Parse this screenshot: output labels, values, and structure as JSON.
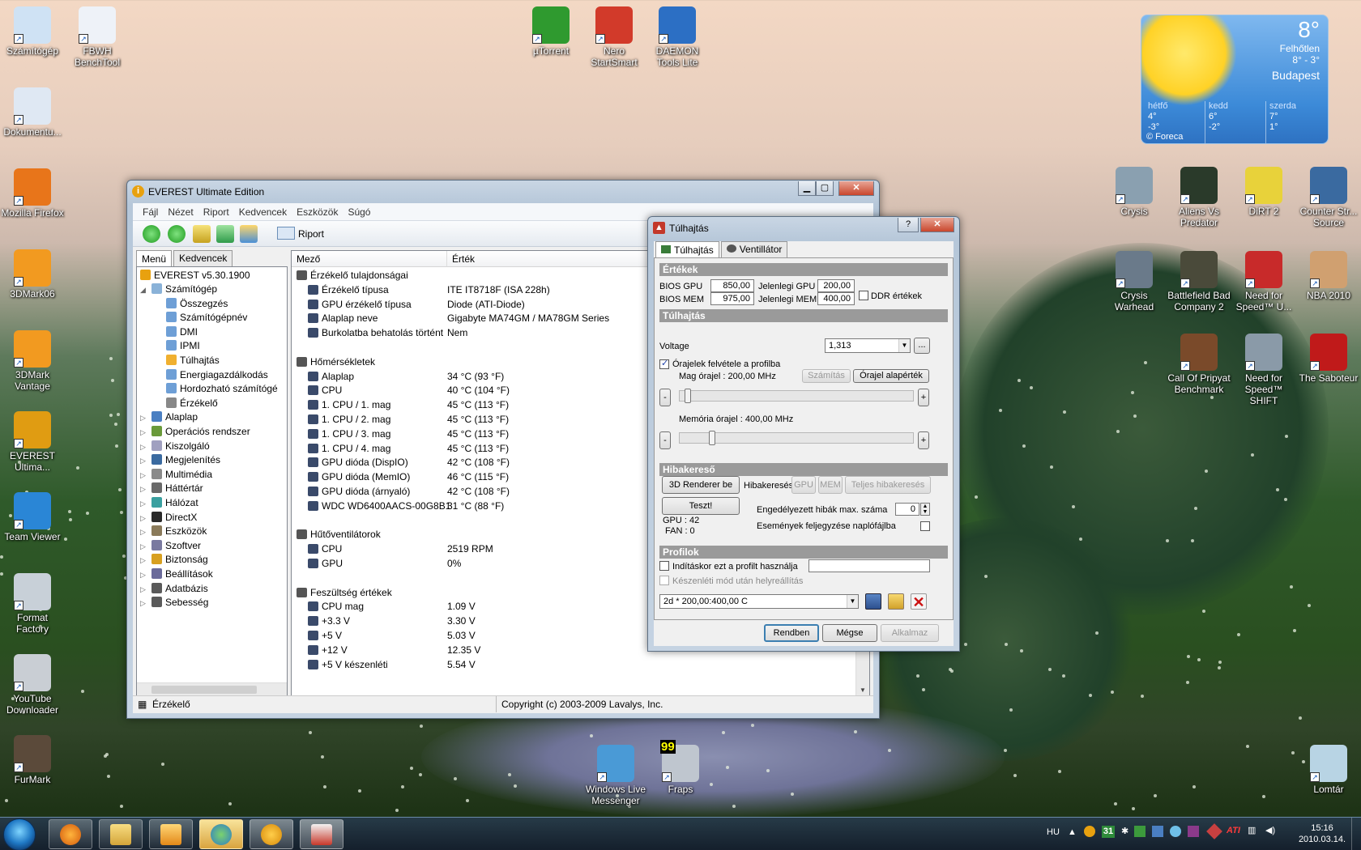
{
  "desktop": {
    "icons_left": [
      {
        "label": "Számítógép",
        "icon": "computer-icon"
      },
      {
        "label": "FBWH BenchTool",
        "icon": "document-icon"
      },
      {
        "label": "Dokumentu...",
        "icon": "document-icon"
      },
      {
        "label": "Mozilla Firefox",
        "icon": "firefox-icon"
      },
      {
        "label": "3DMark06",
        "icon": "3dmark-icon"
      },
      {
        "label": "3DMark Vantage",
        "icon": "3dmark-icon"
      },
      {
        "label": "EVEREST Ultima...",
        "icon": "everest-icon"
      },
      {
        "label": "Team Viewer",
        "icon": "teamviewer-icon"
      },
      {
        "label": "Format Factory",
        "icon": "formatfactory-icon"
      },
      {
        "label": "YouTube Downloader",
        "icon": "youtube-downloader-icon"
      },
      {
        "label": "FurMark",
        "icon": "furmark-icon"
      }
    ],
    "icons_top": [
      {
        "label": "µTorrent",
        "icon": "utorrent-icon"
      },
      {
        "label": "Nero StartSmart",
        "icon": "nero-icon"
      },
      {
        "label": "DAEMON Tools Lite",
        "icon": "daemon-icon"
      }
    ],
    "icons_right": [
      {
        "label": "Crysis",
        "icon": "crysis-icon"
      },
      {
        "label": "Aliens Vs Predator",
        "icon": "avp-icon"
      },
      {
        "label": "DiRT 2",
        "icon": "dirt-icon"
      },
      {
        "label": "Counter Str... Source",
        "icon": "counterstrike-icon"
      },
      {
        "label": "Crysis Warhead",
        "icon": "crysis-icon"
      },
      {
        "label": "Battlefield Bad Company 2",
        "icon": "battlefield-icon"
      },
      {
        "label": "Need for Speed™ U...",
        "icon": "nfs-icon"
      },
      {
        "label": "NBA 2010",
        "icon": "nba-icon"
      },
      {
        "label": "Call Of Pripyat Benchmark",
        "icon": "stalker-icon"
      },
      {
        "label": "Need for Speed™ SHIFT",
        "icon": "nfs-icon"
      },
      {
        "label": "The Saboteur",
        "icon": "saboteur-icon"
      }
    ],
    "icons_bottom": [
      {
        "label": "Windows Live Messenger",
        "icon": "messenger-icon"
      },
      {
        "label": "Fraps",
        "icon": "fraps-icon"
      },
      {
        "label": "Lomtár",
        "icon": "recycle-bin-icon"
      }
    ],
    "fraps_counter": "99"
  },
  "weather": {
    "temp": "8°",
    "condition": "Felhőtlen",
    "range": "8° - 3°",
    "city": "Budapest",
    "days": [
      {
        "name": "hétfő",
        "hi": "4°",
        "lo": "-3°"
      },
      {
        "name": "kedd",
        "hi": "6°",
        "lo": "-2°"
      },
      {
        "name": "szerda",
        "hi": "7°",
        "lo": "1°"
      }
    ],
    "credit": "© Foreca"
  },
  "everest": {
    "title": "EVEREST Ultimate Edition",
    "menu": [
      "Fájl",
      "Nézet",
      "Riport",
      "Kedvencek",
      "Eszközök",
      "Súgó"
    ],
    "report_label": "Riport",
    "tabs": [
      "Menü",
      "Kedvencek"
    ],
    "tree_root": "EVEREST v5.30.1900",
    "tree_computer": "Számítógép",
    "tree_computer_children": [
      "Összegzés",
      "Számítógépnév",
      "DMI",
      "IPMI",
      "Túlhajtás",
      "Energiagazdálkodás",
      "Hordozható számítógé",
      "Érzékelő"
    ],
    "tree_other": [
      "Alaplap",
      "Operációs rendszer",
      "Kiszolgáló",
      "Megjelenítés",
      "Multimédia",
      "Háttértár",
      "Hálózat",
      "DirectX",
      "Eszközök",
      "Szoftver",
      "Biztonság",
      "Beállítások",
      "Adatbázis",
      "Sebesség"
    ],
    "col_field": "Mező",
    "col_value": "Érték",
    "rows": [
      {
        "field": "Érzékelő tulajdonságai",
        "value": "",
        "section": true
      },
      {
        "field": "Érzékelő típusa",
        "value": "ITE IT8718F  (ISA 228h)"
      },
      {
        "field": "GPU érzékelő típusa",
        "value": "Diode  (ATI-Diode)"
      },
      {
        "field": "Alaplap neve",
        "value": "Gigabyte MA74GM / MA78GM Series"
      },
      {
        "field": "Burkolatba behatolás történt",
        "value": "Nem"
      },
      {
        "field": "",
        "value": "",
        "blank": true
      },
      {
        "field": "Hőmérsékletek",
        "value": "",
        "section": true
      },
      {
        "field": "Alaplap",
        "value": "34 °C  (93 °F)"
      },
      {
        "field": "CPU",
        "value": "40 °C  (104 °F)"
      },
      {
        "field": "1. CPU / 1. mag",
        "value": "45 °C  (113 °F)"
      },
      {
        "field": "1. CPU / 2. mag",
        "value": "45 °C  (113 °F)"
      },
      {
        "field": "1. CPU / 3. mag",
        "value": "45 °C  (113 °F)"
      },
      {
        "field": "1. CPU / 4. mag",
        "value": "45 °C  (113 °F)"
      },
      {
        "field": "GPU dióda (DispIO)",
        "value": "42 °C  (108 °F)"
      },
      {
        "field": "GPU dióda (MemIO)",
        "value": "46 °C  (115 °F)"
      },
      {
        "field": "GPU dióda (árnyaló)",
        "value": "42 °C  (108 °F)"
      },
      {
        "field": "WDC WD6400AACS-00G8B1",
        "value": "31 °C  (88 °F)"
      },
      {
        "field": "",
        "value": "",
        "blank": true
      },
      {
        "field": "Hűtőventilátorok",
        "value": "",
        "section": true
      },
      {
        "field": "CPU",
        "value": "2519 RPM"
      },
      {
        "field": "GPU",
        "value": "0%"
      },
      {
        "field": "",
        "value": "",
        "blank": true
      },
      {
        "field": "Feszültség értékek",
        "value": "",
        "section": true
      },
      {
        "field": "CPU mag",
        "value": "1.09 V"
      },
      {
        "field": "+3.3 V",
        "value": "3.30 V"
      },
      {
        "field": "+5 V",
        "value": "5.03 V"
      },
      {
        "field": "+12 V",
        "value": "12.35 V"
      },
      {
        "field": "+5 V készenléti",
        "value": "5.54 V"
      }
    ],
    "status_left": "Érzékelő",
    "status_right": "Copyright (c) 2003-2009 Lavalys, Inc."
  },
  "overclock": {
    "title": "Túlhajtás",
    "tabs": [
      "Túlhajtás",
      "Ventillátor"
    ],
    "sec_values": "Értékek",
    "bios_gpu_label": "BIOS GPU",
    "bios_gpu": "850,00",
    "bios_mem_label": "BIOS MEM",
    "bios_mem": "975,00",
    "cur_gpu_label": "Jelenlegi GPU",
    "cur_gpu": "200,00",
    "cur_mem_label": "Jelenlegi MEM",
    "cur_mem": "400,00",
    "ddr_label": "DDR értékek",
    "sec_oc": "Túlhajtás",
    "voltage_label": "Voltage",
    "voltage": "1,313",
    "more_btn": "...",
    "save_clocks_label": "Órajelek felvétele a profilba",
    "core_clock_label": "Mag órajel : 200,00 MHz",
    "calc_btn": "Számítás",
    "default_btn": "Órajel alapérték",
    "core_slider_level": 0.02,
    "mem_clock_label": "Memória órajel : 400,00 MHz",
    "mem_slider_level": 0.13,
    "minus": "-",
    "plus": "+",
    "sec_debug": "Hibakereső",
    "renderer_btn": "3D Renderer be",
    "debug_label": "Hibakeresés",
    "gpu_btn": "GPU",
    "mem_btn": "MEM",
    "full_debug_btn": "Teljes hibakeresés",
    "test_btn": "Teszt!",
    "max_errors_label": "Engedélyezett hibák max. száma",
    "max_errors": "0",
    "log_label": "Események feljegyzése naplófájlba",
    "gpu_status": "GPU : 42",
    "fan_status": "FAN : 0",
    "sec_profiles": "Profilok",
    "startup_profile_label": "Indításkor ezt a profilt használja",
    "restore_label": "Készenléti mód után helyreállítás",
    "profile": "2d * 200,00:400,00 C",
    "ok_btn": "Rendben",
    "cancel_btn": "Mégse",
    "apply_btn": "Alkalmaz"
  },
  "taskbar": {
    "language": "HU",
    "time": "15:16",
    "date": "2010.03.14.",
    "tray_calendar": "31",
    "tray_ati": "ATI"
  }
}
